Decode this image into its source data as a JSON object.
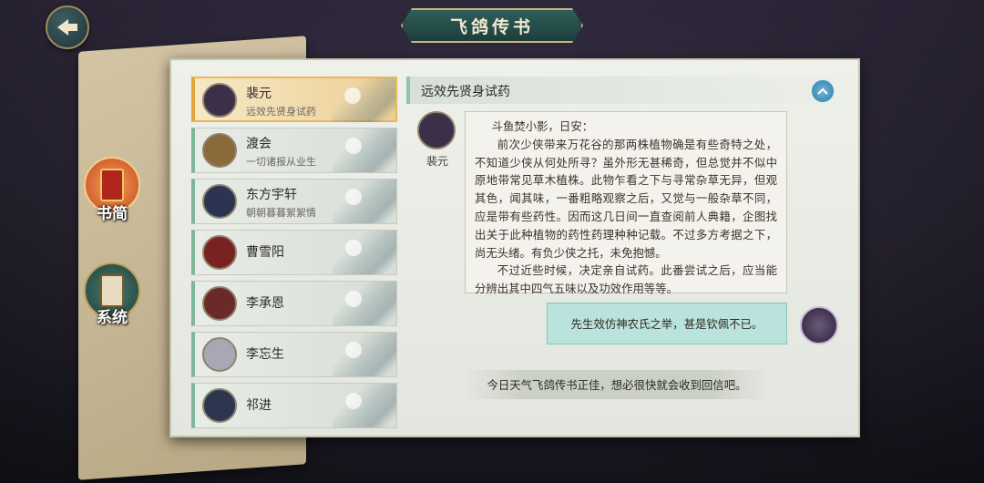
{
  "header": {
    "title": "飞鸽传书",
    "back_icon": "back-arrow-icon"
  },
  "side_menu": [
    {
      "label": "书简",
      "icon": "letter-scroll-icon",
      "active": true
    },
    {
      "label": "系统",
      "icon": "system-scroll-icon",
      "active": false
    }
  ],
  "contacts": [
    {
      "name": "裴元",
      "subtitle": "远效先贤身试药",
      "active": true,
      "avatar_color": "#3b2f4a"
    },
    {
      "name": "渡会",
      "subtitle": "一切诸报从业生",
      "active": false,
      "avatar_color": "#8a6a3a"
    },
    {
      "name": "东方宇轩",
      "subtitle": "朝朝暮暮絮絮情",
      "active": false,
      "avatar_color": "#2b3450"
    },
    {
      "name": "曹雪阳",
      "subtitle": "",
      "active": false,
      "avatar_color": "#7a2222"
    },
    {
      "name": "李承恩",
      "subtitle": "",
      "active": false,
      "avatar_color": "#6a2a2a"
    },
    {
      "name": "李忘生",
      "subtitle": "",
      "active": false,
      "avatar_color": "#a8a8b4"
    },
    {
      "name": "祁进",
      "subtitle": "",
      "active": false,
      "avatar_color": "#2c3650"
    }
  ],
  "conversation": {
    "title": "远效先贤身试药",
    "sender_name": "裴元",
    "letter_paragraphs": [
      "斗鱼焚小影，日安：",
      "前次少侠带来万花谷的那两株植物确是有些奇特之处，不知道少侠从何处所寻？虽外形无甚稀奇，但总觉并不似中原地带常见草木植株。此物乍看之下与寻常杂草无异，但观其色，闻其味，一番粗略观察之后，又觉与一般杂草不同，应是带有些药性。因而这几日间一直查阅前人典籍，企图找出关于此种植物的药性药理种种记载。不过多方考据之下，尚无头绪。有负少侠之托，未免抱憾。",
      "不过近些时候，决定亲自试药。此番尝试之后，应当能分辨出其中四气五味以及功效作用等等。"
    ],
    "reply": "先生效仿神农氏之举，甚是钦佩不已。",
    "notice": "今日天气飞鸽传书正佳，想必很快就会收到回信吧。"
  },
  "colors": {
    "panel_bg": "#e8ebe5",
    "active_contact": "#eccf96",
    "reply_bubble": "#b9e3dc",
    "title_banner": "#2f5e5a"
  }
}
